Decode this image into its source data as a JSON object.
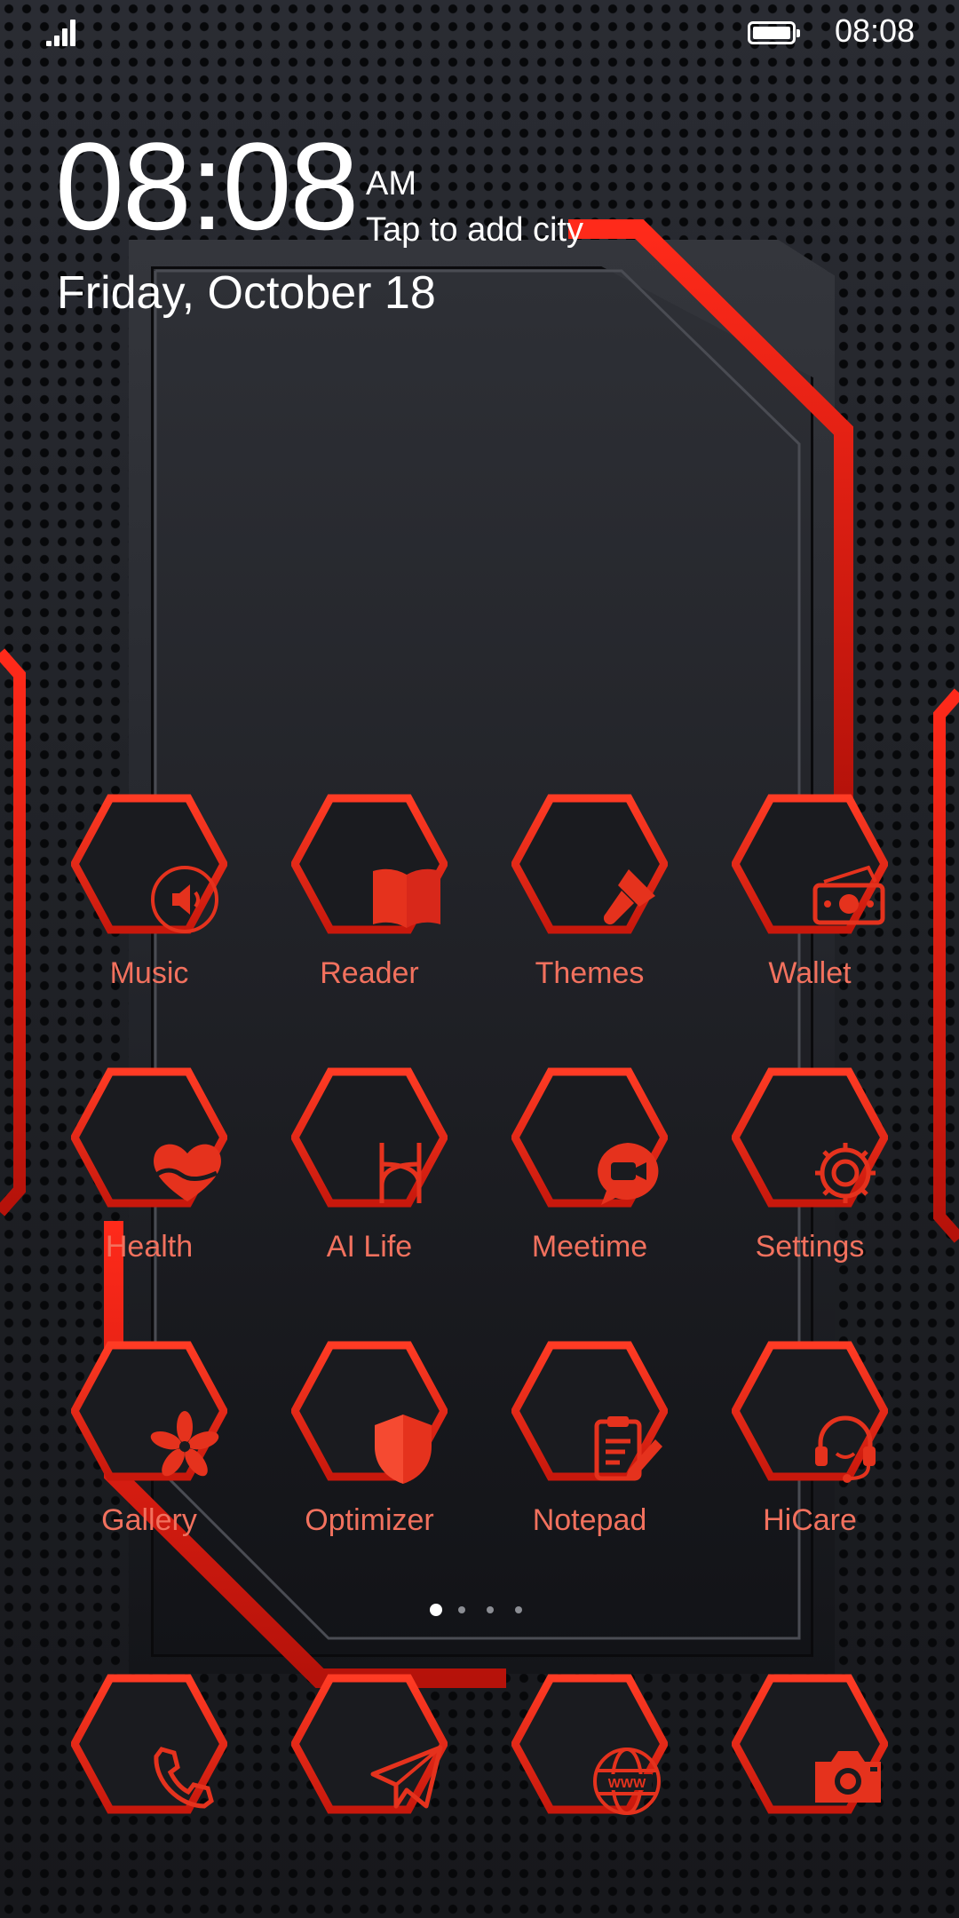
{
  "status_bar": {
    "time": "08:08",
    "battery_level": 1.0
  },
  "clock": {
    "time": "08:08",
    "ampm": "AM",
    "city_prompt": "Tap to add city",
    "date": "Friday, October 18"
  },
  "theme": {
    "accent": "#e5321d",
    "label_color": "#f2715e",
    "hex_fill": "#1a1b1f"
  },
  "apps": [
    {
      "label": "Music",
      "icon": "speaker-icon"
    },
    {
      "label": "Reader",
      "icon": "book-icon"
    },
    {
      "label": "Themes",
      "icon": "paintbrush-icon"
    },
    {
      "label": "Wallet",
      "icon": "wallet-icon"
    },
    {
      "label": "Health",
      "icon": "heart-icon"
    },
    {
      "label": "AI Life",
      "icon": "ai-life-icon"
    },
    {
      "label": "Meetime",
      "icon": "video-chat-icon"
    },
    {
      "label": "Settings",
      "icon": "gear-icon"
    },
    {
      "label": "Gallery",
      "icon": "flower-icon"
    },
    {
      "label": "Optimizer",
      "icon": "shield-icon"
    },
    {
      "label": "Notepad",
      "icon": "clipboard-pen-icon"
    },
    {
      "label": "HiCare",
      "icon": "headset-icon"
    }
  ],
  "pager": {
    "pages": 4,
    "current": 1
  },
  "dock": [
    {
      "icon": "phone-icon"
    },
    {
      "icon": "paper-plane-icon"
    },
    {
      "icon": "www-globe-icon",
      "text": "WWW"
    },
    {
      "icon": "camera-icon"
    }
  ]
}
